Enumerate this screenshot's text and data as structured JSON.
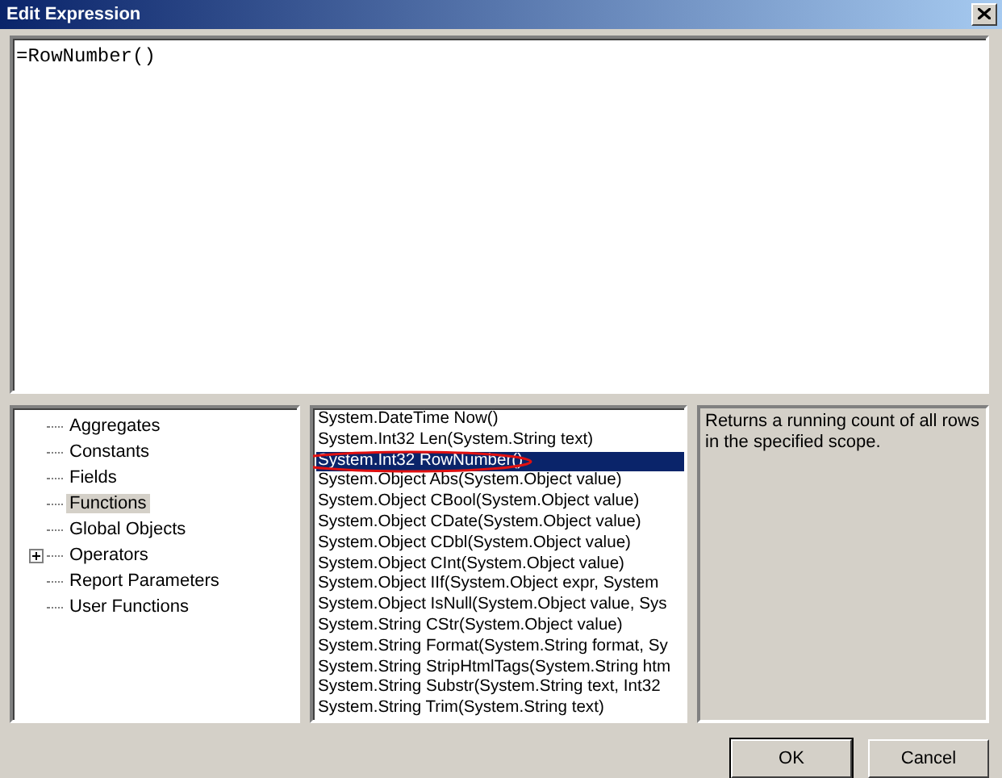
{
  "window": {
    "title": "Edit Expression"
  },
  "expression": {
    "value": "=RowNumber()"
  },
  "categories": [
    {
      "label": "Aggregates",
      "selected": false
    },
    {
      "label": "Constants",
      "selected": false
    },
    {
      "label": "Fields",
      "selected": false
    },
    {
      "label": "Functions",
      "selected": true
    },
    {
      "label": "Global Objects",
      "selected": false
    },
    {
      "label": "Operators",
      "selected": false,
      "expanded": false
    },
    {
      "label": "Report Parameters",
      "selected": false
    },
    {
      "label": "User Functions",
      "selected": false
    }
  ],
  "members": [
    {
      "label": "System.DateTime Now()",
      "selected": false,
      "circled": false
    },
    {
      "label": "System.Int32 Len(System.String text)",
      "selected": false,
      "circled": false
    },
    {
      "label": "System.Int32 RowNumber()",
      "selected": true,
      "circled": true
    },
    {
      "label": "System.Object Abs(System.Object value)",
      "selected": false,
      "circled": false
    },
    {
      "label": "System.Object CBool(System.Object value)",
      "selected": false,
      "circled": false
    },
    {
      "label": "System.Object CDate(System.Object value)",
      "selected": false,
      "circled": false
    },
    {
      "label": "System.Object CDbl(System.Object value)",
      "selected": false,
      "circled": false
    },
    {
      "label": "System.Object CInt(System.Object value)",
      "selected": false,
      "circled": false
    },
    {
      "label": "System.Object IIf(System.Object expr, System",
      "selected": false,
      "circled": false
    },
    {
      "label": "System.Object IsNull(System.Object value, Sys",
      "selected": false,
      "circled": false
    },
    {
      "label": "System.String CStr(System.Object value)",
      "selected": false,
      "circled": false
    },
    {
      "label": "System.String Format(System.String format, Sy",
      "selected": false,
      "circled": false
    },
    {
      "label": "System.String StripHtmlTags(System.String htm",
      "selected": false,
      "circled": false
    },
    {
      "label": "System.String Substr(System.String text, Int32",
      "selected": false,
      "circled": false
    },
    {
      "label": "System.String Trim(System.String text)",
      "selected": false,
      "circled": false
    }
  ],
  "description": "Returns a running count of all rows in the specified scope.",
  "buttons": [
    {
      "label": "OK",
      "default": true
    },
    {
      "label": "Cancel",
      "default": false
    }
  ]
}
